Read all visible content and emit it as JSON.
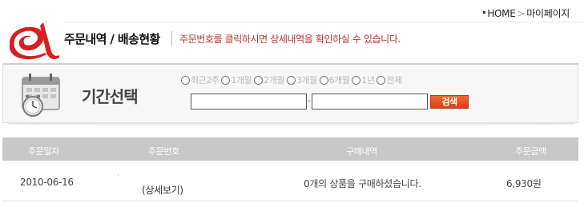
{
  "breadcrumb": {
    "home": "HOME",
    "separator": ">",
    "current": "마이페이지"
  },
  "header": {
    "title": "주문내역 / 배송현황",
    "description": "주문번호를 클릭하시면 상세내역을 확인하실 수 있습니다."
  },
  "period": {
    "label": "기간선택",
    "options": [
      {
        "label": "최근2주"
      },
      {
        "label": "1개월"
      },
      {
        "label": "2개월"
      },
      {
        "label": "3개월"
      },
      {
        "label": "6개월"
      },
      {
        "label": "1년"
      },
      {
        "label": "전체"
      }
    ],
    "from_value": "",
    "to_value": "",
    "range_separator": "-",
    "search_label": "검색"
  },
  "table": {
    "columns": {
      "date": "주문일자",
      "order_no": "주문번호",
      "items": "구매내역",
      "amount": "주문금액"
    },
    "rows": [
      {
        "date": "2010-06-16",
        "order_no": "·",
        "detail_link": "(상세보기)",
        "items": "0개의 상품을 구매하셨습니다.",
        "amount": "6,930원"
      }
    ]
  },
  "colors": {
    "accent_red": "#d81e1e",
    "description_text": "#b5342a",
    "search_button": "#e8521f",
    "table_header": "#c8c8c8"
  },
  "icons": {
    "logo": "brand-swoosh-logo",
    "calendar": "calendar-clock-icon"
  }
}
